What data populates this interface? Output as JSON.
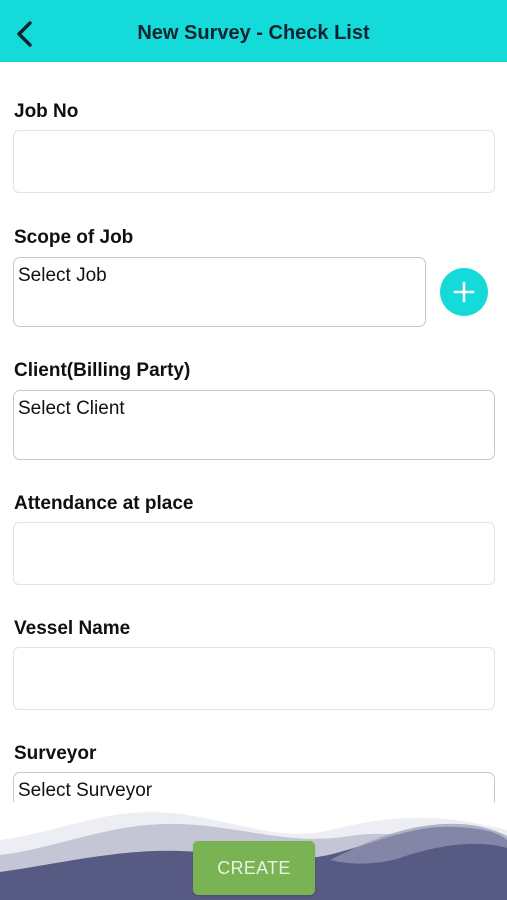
{
  "header": {
    "title": "New Survey - Check List",
    "back_icon": "chevron-left-icon",
    "background": "#14dad9"
  },
  "form": {
    "job_no": {
      "label": "Job No",
      "value": ""
    },
    "scope_of_job": {
      "label": "Scope of Job",
      "value": "Select Job",
      "add_icon": "plus-icon"
    },
    "client": {
      "label": "Client(Billing Party)",
      "value": "Select Client"
    },
    "attendance": {
      "label": "Attendance at place",
      "value": ""
    },
    "vessel_name": {
      "label": "Vessel Name",
      "value": ""
    },
    "surveyor": {
      "label": "Surveyor",
      "value": "Select Surveyor"
    }
  },
  "footer": {
    "create_label": "CREATE",
    "create_color": "#79b354",
    "wave_color": "#575a82"
  }
}
